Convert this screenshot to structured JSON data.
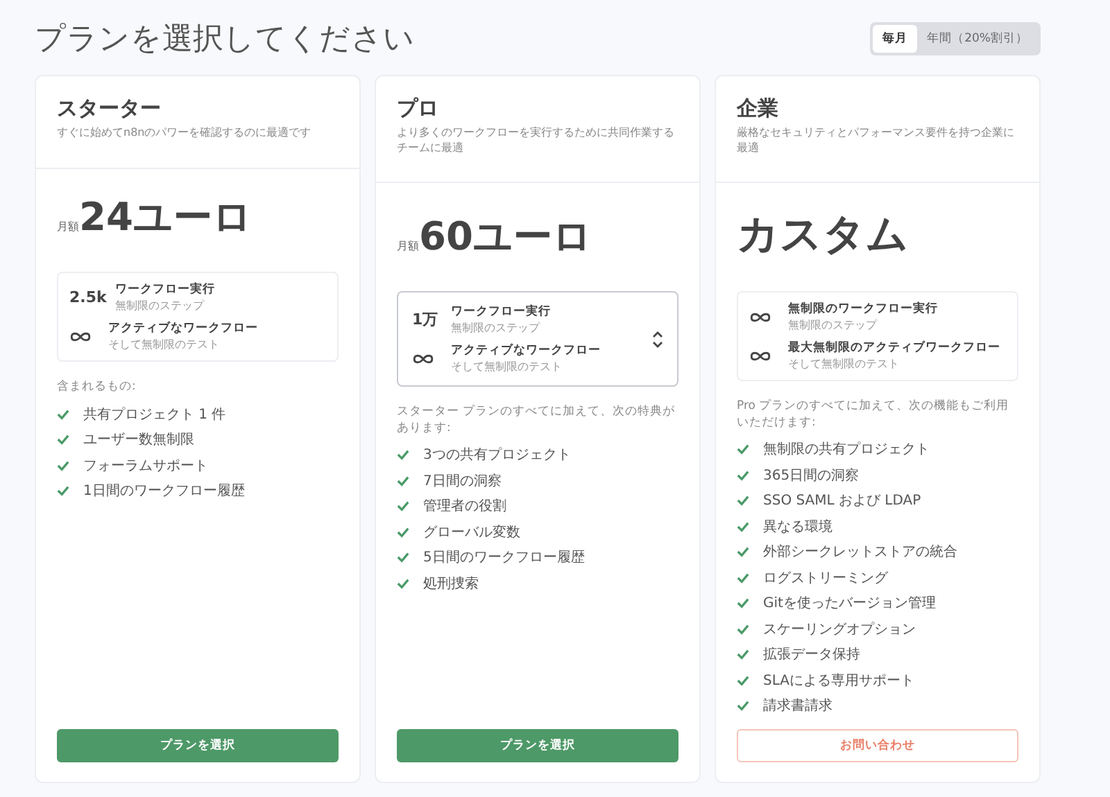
{
  "title": "プランを選択してください",
  "billing_toggle": [
    {
      "label": "毎月",
      "selected": true
    },
    {
      "label": "年間（20%割引）",
      "selected": false
    }
  ],
  "plans": [
    {
      "name": "スターター",
      "description": "すぐに始めてn8nのパワーを確認するのに最適です",
      "price_prefix": "月額",
      "price": "24ユーロ",
      "usage_selectable": false,
      "usage": [
        {
          "kind": "value",
          "value": "2.5k",
          "title": "ワークフロー実行",
          "subtitle": "無制限のステップ"
        },
        {
          "kind": "infinity",
          "title": "アクティブなワークフロー",
          "subtitle": "そして無制限のテスト"
        }
      ],
      "features_intro": "含まれるもの:",
      "features": [
        "共有プロジェクト 1 件",
        "ユーザー数無制限",
        "フォーラムサポート",
        "1日間のワークフロー履歴"
      ],
      "button": {
        "label": "プランを選択",
        "kind": "primary"
      }
    },
    {
      "name": "プロ",
      "description": "より多くのワークフローを実行するために共同作業するチームに最適",
      "price_prefix": "月額",
      "price": "60ユーロ",
      "usage_selectable": true,
      "usage": [
        {
          "kind": "value",
          "value": "1万",
          "title": "ワークフロー実行",
          "subtitle": "無制限のステップ"
        },
        {
          "kind": "infinity",
          "title": "アクティブなワークフロー",
          "subtitle": "そして無制限のテスト"
        }
      ],
      "features_intro": "スターター プランのすべてに加えて、次の特典があります:",
      "features": [
        "3つの共有プロジェクト",
        "7日間の洞察",
        "管理者の役割",
        "グローバル変数",
        "5日間のワークフロー履歴",
        "処刑捜索"
      ],
      "button": {
        "label": "プランを選択",
        "kind": "primary"
      }
    },
    {
      "name": "企業",
      "description": "厳格なセキュリティとパフォーマンス要件を持つ企業に最適",
      "price": "カスタム",
      "usage_selectable": false,
      "usage": [
        {
          "kind": "infinity",
          "title": "無制限のワークフロー実行",
          "subtitle": "無制限のステップ"
        },
        {
          "kind": "infinity",
          "title": "最大無制限のアクティブワークフロー",
          "subtitle": "そして無制限のテスト"
        }
      ],
      "features_intro": "Pro プランのすべてに加えて、次の機能もご利用いただけます:",
      "features": [
        "無制限の共有プロジェクト",
        "365日間の洞察",
        "SSO SAML および LDAP",
        "異なる環境",
        "外部シークレットストアの統合",
        "ログストリーミング",
        "Gitを使ったバージョン管理",
        "スケーリングオプション",
        "拡張データ保持",
        "SLAによる専用サポート",
        "請求書請求"
      ],
      "button": {
        "label": "お問い合わせ",
        "kind": "outline"
      }
    }
  ]
}
